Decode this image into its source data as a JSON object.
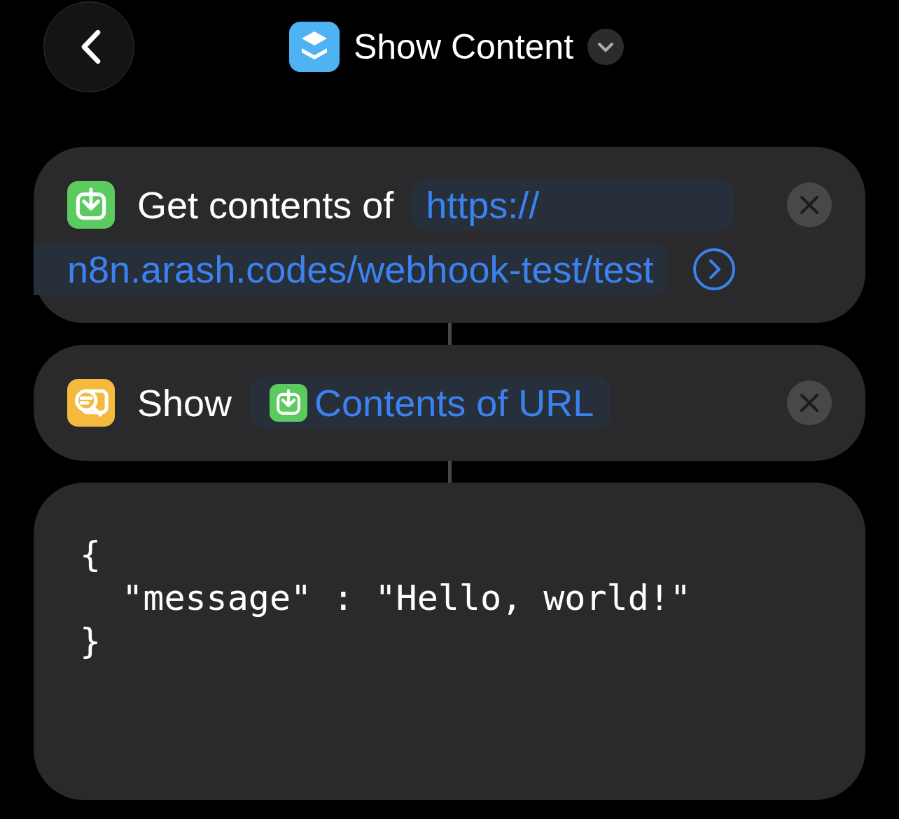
{
  "header": {
    "title": "Show Content"
  },
  "actions": [
    {
      "kind": "get_contents",
      "label": "Get contents of",
      "url_lines": [
        "https://",
        "n8n.arash.codes/webhook-test/test"
      ]
    },
    {
      "kind": "show",
      "label": "Show",
      "variable": "Contents of URL"
    }
  ],
  "output": {
    "lines": [
      "{",
      "  \"message\" : \"Hello, world!\"",
      "}"
    ]
  }
}
